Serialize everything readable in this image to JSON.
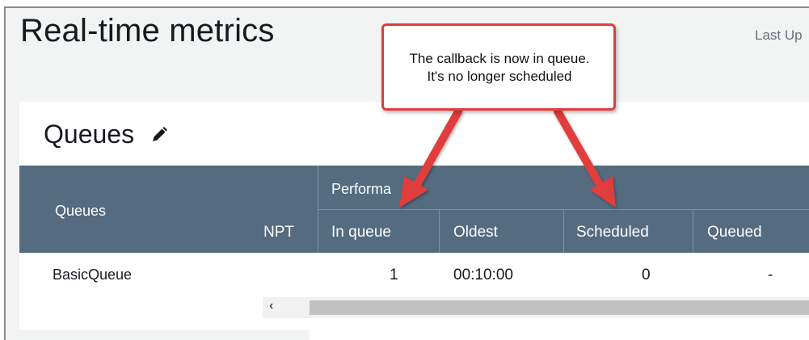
{
  "header": {
    "title": "Real-time metrics",
    "last_updated_partial": "Last Up"
  },
  "card": {
    "title": "Queues",
    "edit_icon": "pencil-icon"
  },
  "table": {
    "left_header": "Queues",
    "partial_column_header": "NPT",
    "group_header": "Performa",
    "columns": [
      "In queue",
      "Oldest",
      "Scheduled",
      "Queued"
    ],
    "rows": [
      {
        "queue": "BasicQueue",
        "in_queue": "1",
        "oldest": "00:10:00",
        "scheduled": "0",
        "queued": "-"
      }
    ]
  },
  "scrollbar": {
    "left_arrow": "‹"
  },
  "annotation": {
    "line1": "The callback is now in queue.",
    "line2": "It's no longer scheduled",
    "color": "#e03c3c"
  }
}
